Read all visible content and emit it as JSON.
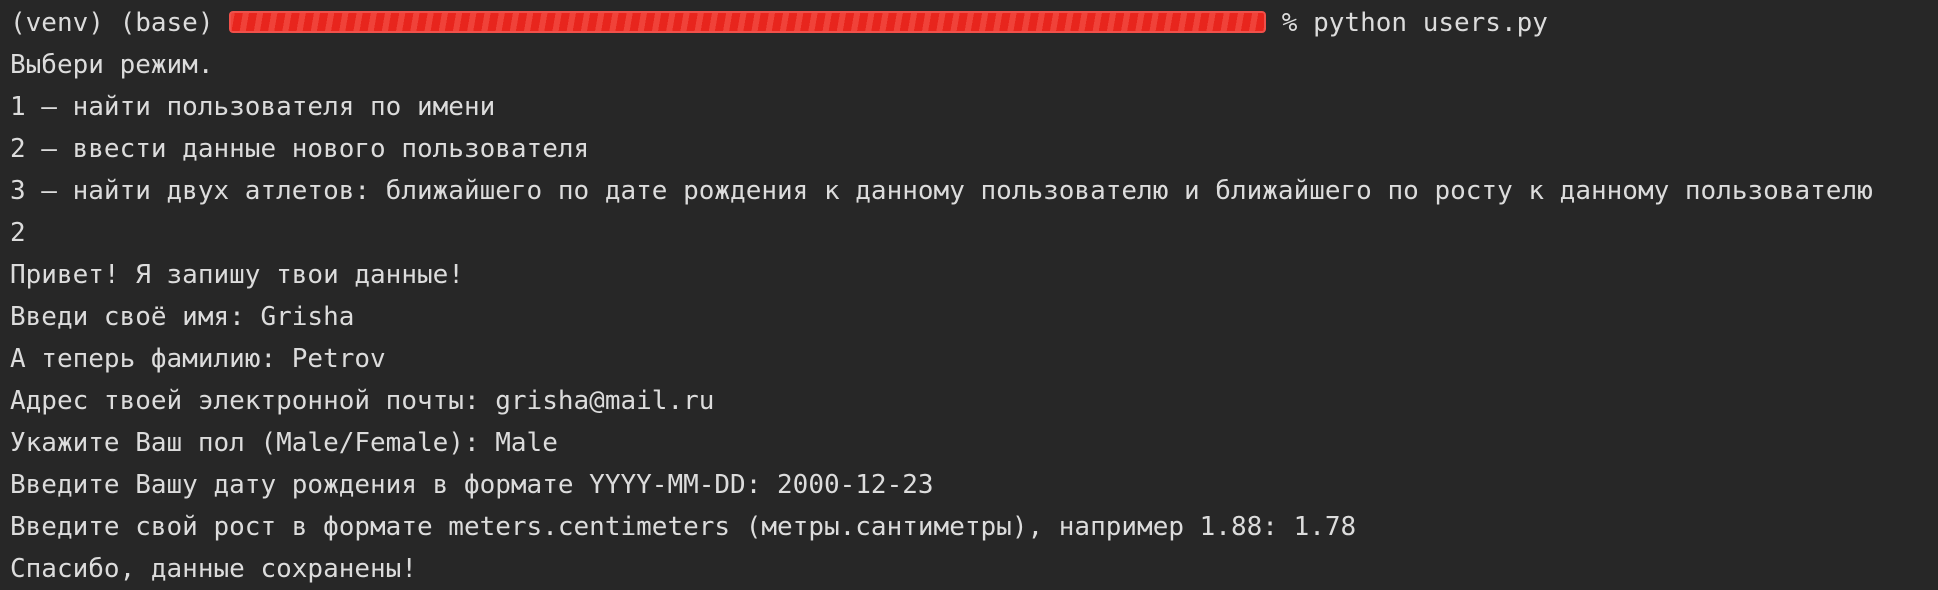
{
  "terminal": {
    "prompt": {
      "prefix": "(venv) (base) ",
      "suffix": " % python users.py"
    },
    "lines": [
      "Выбери режим.",
      "1 – найти пользователя по имени",
      "2 – ввести данные нового пользователя",
      "3 – найти двух атлетов: ближайшего по дате рождения к данному пользователю и ближайшего по росту к данному пользователю",
      "2",
      "Привет! Я запишу твои данные!",
      "Введи своё имя: Grisha",
      "А теперь фамилию: Petrov",
      "Адрес твоей электронной почты: grisha@mail.ru",
      "Укажите Ваш пол (Male/Female): Male",
      "Введите Вашу дату рождения в формате YYYY-MM-DD: 2000-12-23",
      "Введите свой рост в формате meters.centimeters (метры.сантиметры), например 1.88: 1.78",
      "Спасибо, данные сохранены!"
    ]
  }
}
